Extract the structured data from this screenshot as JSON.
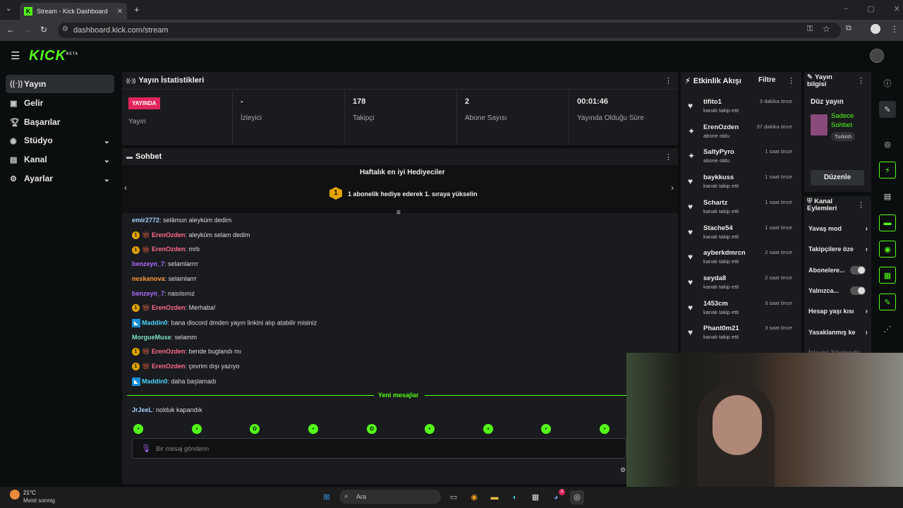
{
  "browser": {
    "tab_title": "Stream - Kick Dashboard",
    "url": "dashboard.kick.com/stream",
    "new_tab": "+"
  },
  "header": {
    "logo": "KICK",
    "logo_badge": "BETA"
  },
  "sidebar": {
    "items": [
      {
        "label": "Yayın",
        "icon": "broadcast-icon"
      },
      {
        "label": "Gelir",
        "icon": "wallet-icon"
      },
      {
        "label": "Başarılar",
        "icon": "trophy-icon"
      },
      {
        "label": "Stüdyo",
        "icon": "studio-icon"
      },
      {
        "label": "Kanal",
        "icon": "channel-icon"
      },
      {
        "label": "Ayarlar",
        "icon": "gear-icon"
      }
    ]
  },
  "stats": {
    "title": "Yayın İstatistikleri",
    "live_badge": "YAYINDA",
    "live_label": "Yayın",
    "viewers_value": "-",
    "viewers_label": "İzleyici",
    "followers_value": "178",
    "followers_label": "Takipçi",
    "subs_value": "2",
    "subs_label": "Abone Sayısı",
    "uptime_value": "00:01:46",
    "uptime_label": "Yayında Olduğu Süre"
  },
  "chat": {
    "title": "Sohbet",
    "gifters_title": "Haftalık en iyi Hediyeciler",
    "gifters_text": "1 abonelik hediye ederek 1. sıraya yükselin",
    "rank_badge": "1",
    "messages": [
      {
        "user": "emir2772",
        "text": ": selâmun aleyküm dedim",
        "color": "#a9d1ff",
        "badges": ""
      },
      {
        "user": "ErenOzden",
        "text": ": aleyküm selam dedim",
        "color": "#ff6b8a",
        "badges": "sub"
      },
      {
        "user": "ErenOzden",
        "text": ": mrb",
        "color": "#ff6b8a",
        "badges": "sub"
      },
      {
        "user": "benzeyn_7",
        "text": ": selamlarrrr",
        "color": "#b06cff",
        "badges": ""
      },
      {
        "user": "neskanova",
        "text": ": selamlarrr",
        "color": "#ff9a3c",
        "badges": ""
      },
      {
        "user": "benzeyn_7",
        "text": ": nasılsınız",
        "color": "#b06cff",
        "badges": ""
      },
      {
        "user": "ErenOzden",
        "text": ": Merhaba!",
        "color": "#ff6b8a",
        "badges": "sub"
      },
      {
        "user": "Maddin0",
        "text": ": bana discord dmden yayın linkini alıp atabilir misiniz",
        "color": "#4dd4ff",
        "badges": "kick"
      },
      {
        "user": "MorgueMuse",
        "text": ": selamm",
        "color": "#7ee0c8",
        "badges": ""
      },
      {
        "user": "ErenOzden",
        "text": ": bende buglandı mı",
        "color": "#ff6b8a",
        "badges": "sub"
      },
      {
        "user": "ErenOzden",
        "text": ": çevrim dışı yazıyo",
        "color": "#ff6b8a",
        "badges": "sub"
      },
      {
        "user": "Maddin0",
        "text": ": daha başlamadı",
        "color": "#4dd4ff",
        "badges": "kick"
      }
    ],
    "new_messages_label": "Yeni mesajlar",
    "after_messages": [
      {
        "user": "JrJeeL",
        "text": ": nolduk kapandık",
        "color": "#a9d1ff",
        "badges": ""
      }
    ],
    "input_placeholder": "Bir mesaj gönderin"
  },
  "activity": {
    "title": "Etkinlik Akışı",
    "filter_label": "Filtre",
    "events": [
      {
        "name": "tifito1",
        "action": "kanalı takip etti",
        "time": "3 dakika önce",
        "icon": "heart-icon"
      },
      {
        "name": "ErenOzden",
        "action": "abone oldu",
        "time": "37 dakika önce",
        "icon": "star-icon"
      },
      {
        "name": "SaltyPyro",
        "action": "abone oldu",
        "time": "1 saat önce",
        "icon": "star-icon"
      },
      {
        "name": "baykkuss",
        "action": "kanalı takip etti",
        "time": "1 saat önce",
        "icon": "heart-icon"
      },
      {
        "name": "Schartz",
        "action": "kanalı takip etti",
        "time": "1 saat önce",
        "icon": "heart-icon"
      },
      {
        "name": "Stache54",
        "action": "kanalı takip etti",
        "time": "1 saat önce",
        "icon": "heart-icon"
      },
      {
        "name": "ayberkdmrcn",
        "action": "kanalı takip etti",
        "time": "2 saat önce",
        "icon": "heart-icon"
      },
      {
        "name": "seyda8",
        "action": "kanalı takip etti",
        "time": "2 saat önce",
        "icon": "heart-icon"
      },
      {
        "name": "1453cm",
        "action": "kanalı takip etti",
        "time": "3 saat önce",
        "icon": "heart-icon"
      },
      {
        "name": "Phant0m21",
        "action": "kanalı takip etti",
        "time": "3 saat önce",
        "icon": "heart-icon"
      }
    ]
  },
  "stream_info": {
    "title": "Yayın bilgisi",
    "stream_title": "Düz yayın",
    "category": "Sadece Sohbet",
    "language": "Turkish",
    "edit_button": "Düzenle"
  },
  "channel_actions": {
    "title": "Kanal Eylemleri",
    "items": [
      {
        "label": "Yavaş mod",
        "kind": "chevron"
      },
      {
        "label": "Takipçilere öze",
        "kind": "chevron"
      },
      {
        "label": "Abonelere...",
        "kind": "toggle"
      },
      {
        "label": "Yalnızca...",
        "kind": "toggle"
      },
      {
        "label": "Hesap yaşı kısı",
        "kind": "chevron"
      },
      {
        "label": "Yasaklanmış ke",
        "kind": "chevron"
      },
      {
        "label": "İzleyici Yönlendir",
        "kind": "none"
      }
    ]
  },
  "taskbar": {
    "temp": "21°C",
    "weather": "Meist sonnig",
    "search_label": "Ara",
    "discord_badge": "3"
  },
  "colors": {
    "accent": "#53fc18",
    "live": "#e0245e",
    "panel": "#191b1f"
  }
}
